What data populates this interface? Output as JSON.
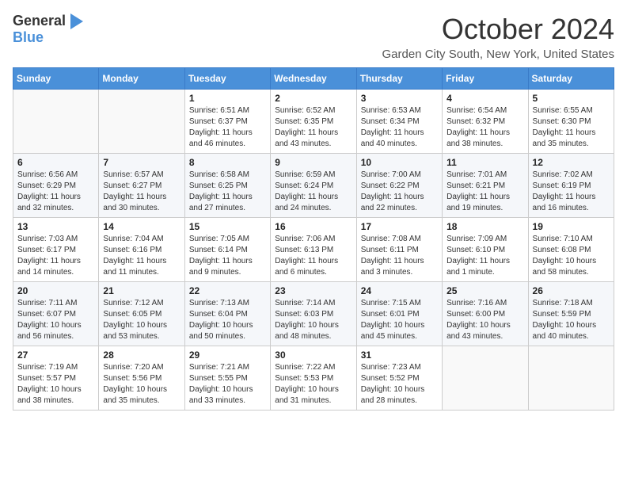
{
  "header": {
    "logo_general": "General",
    "logo_blue": "Blue",
    "month_title": "October 2024",
    "location": "Garden City South, New York, United States"
  },
  "days_of_week": [
    "Sunday",
    "Monday",
    "Tuesday",
    "Wednesday",
    "Thursday",
    "Friday",
    "Saturday"
  ],
  "weeks": [
    [
      {
        "day": "",
        "info": ""
      },
      {
        "day": "",
        "info": ""
      },
      {
        "day": "1",
        "info": "Sunrise: 6:51 AM\nSunset: 6:37 PM\nDaylight: 11 hours and 46 minutes."
      },
      {
        "day": "2",
        "info": "Sunrise: 6:52 AM\nSunset: 6:35 PM\nDaylight: 11 hours and 43 minutes."
      },
      {
        "day": "3",
        "info": "Sunrise: 6:53 AM\nSunset: 6:34 PM\nDaylight: 11 hours and 40 minutes."
      },
      {
        "day": "4",
        "info": "Sunrise: 6:54 AM\nSunset: 6:32 PM\nDaylight: 11 hours and 38 minutes."
      },
      {
        "day": "5",
        "info": "Sunrise: 6:55 AM\nSunset: 6:30 PM\nDaylight: 11 hours and 35 minutes."
      }
    ],
    [
      {
        "day": "6",
        "info": "Sunrise: 6:56 AM\nSunset: 6:29 PM\nDaylight: 11 hours and 32 minutes."
      },
      {
        "day": "7",
        "info": "Sunrise: 6:57 AM\nSunset: 6:27 PM\nDaylight: 11 hours and 30 minutes."
      },
      {
        "day": "8",
        "info": "Sunrise: 6:58 AM\nSunset: 6:25 PM\nDaylight: 11 hours and 27 minutes."
      },
      {
        "day": "9",
        "info": "Sunrise: 6:59 AM\nSunset: 6:24 PM\nDaylight: 11 hours and 24 minutes."
      },
      {
        "day": "10",
        "info": "Sunrise: 7:00 AM\nSunset: 6:22 PM\nDaylight: 11 hours and 22 minutes."
      },
      {
        "day": "11",
        "info": "Sunrise: 7:01 AM\nSunset: 6:21 PM\nDaylight: 11 hours and 19 minutes."
      },
      {
        "day": "12",
        "info": "Sunrise: 7:02 AM\nSunset: 6:19 PM\nDaylight: 11 hours and 16 minutes."
      }
    ],
    [
      {
        "day": "13",
        "info": "Sunrise: 7:03 AM\nSunset: 6:17 PM\nDaylight: 11 hours and 14 minutes."
      },
      {
        "day": "14",
        "info": "Sunrise: 7:04 AM\nSunset: 6:16 PM\nDaylight: 11 hours and 11 minutes."
      },
      {
        "day": "15",
        "info": "Sunrise: 7:05 AM\nSunset: 6:14 PM\nDaylight: 11 hours and 9 minutes."
      },
      {
        "day": "16",
        "info": "Sunrise: 7:06 AM\nSunset: 6:13 PM\nDaylight: 11 hours and 6 minutes."
      },
      {
        "day": "17",
        "info": "Sunrise: 7:08 AM\nSunset: 6:11 PM\nDaylight: 11 hours and 3 minutes."
      },
      {
        "day": "18",
        "info": "Sunrise: 7:09 AM\nSunset: 6:10 PM\nDaylight: 11 hours and 1 minute."
      },
      {
        "day": "19",
        "info": "Sunrise: 7:10 AM\nSunset: 6:08 PM\nDaylight: 10 hours and 58 minutes."
      }
    ],
    [
      {
        "day": "20",
        "info": "Sunrise: 7:11 AM\nSunset: 6:07 PM\nDaylight: 10 hours and 56 minutes."
      },
      {
        "day": "21",
        "info": "Sunrise: 7:12 AM\nSunset: 6:05 PM\nDaylight: 10 hours and 53 minutes."
      },
      {
        "day": "22",
        "info": "Sunrise: 7:13 AM\nSunset: 6:04 PM\nDaylight: 10 hours and 50 minutes."
      },
      {
        "day": "23",
        "info": "Sunrise: 7:14 AM\nSunset: 6:03 PM\nDaylight: 10 hours and 48 minutes."
      },
      {
        "day": "24",
        "info": "Sunrise: 7:15 AM\nSunset: 6:01 PM\nDaylight: 10 hours and 45 minutes."
      },
      {
        "day": "25",
        "info": "Sunrise: 7:16 AM\nSunset: 6:00 PM\nDaylight: 10 hours and 43 minutes."
      },
      {
        "day": "26",
        "info": "Sunrise: 7:18 AM\nSunset: 5:59 PM\nDaylight: 10 hours and 40 minutes."
      }
    ],
    [
      {
        "day": "27",
        "info": "Sunrise: 7:19 AM\nSunset: 5:57 PM\nDaylight: 10 hours and 38 minutes."
      },
      {
        "day": "28",
        "info": "Sunrise: 7:20 AM\nSunset: 5:56 PM\nDaylight: 10 hours and 35 minutes."
      },
      {
        "day": "29",
        "info": "Sunrise: 7:21 AM\nSunset: 5:55 PM\nDaylight: 10 hours and 33 minutes."
      },
      {
        "day": "30",
        "info": "Sunrise: 7:22 AM\nSunset: 5:53 PM\nDaylight: 10 hours and 31 minutes."
      },
      {
        "day": "31",
        "info": "Sunrise: 7:23 AM\nSunset: 5:52 PM\nDaylight: 10 hours and 28 minutes."
      },
      {
        "day": "",
        "info": ""
      },
      {
        "day": "",
        "info": ""
      }
    ]
  ]
}
